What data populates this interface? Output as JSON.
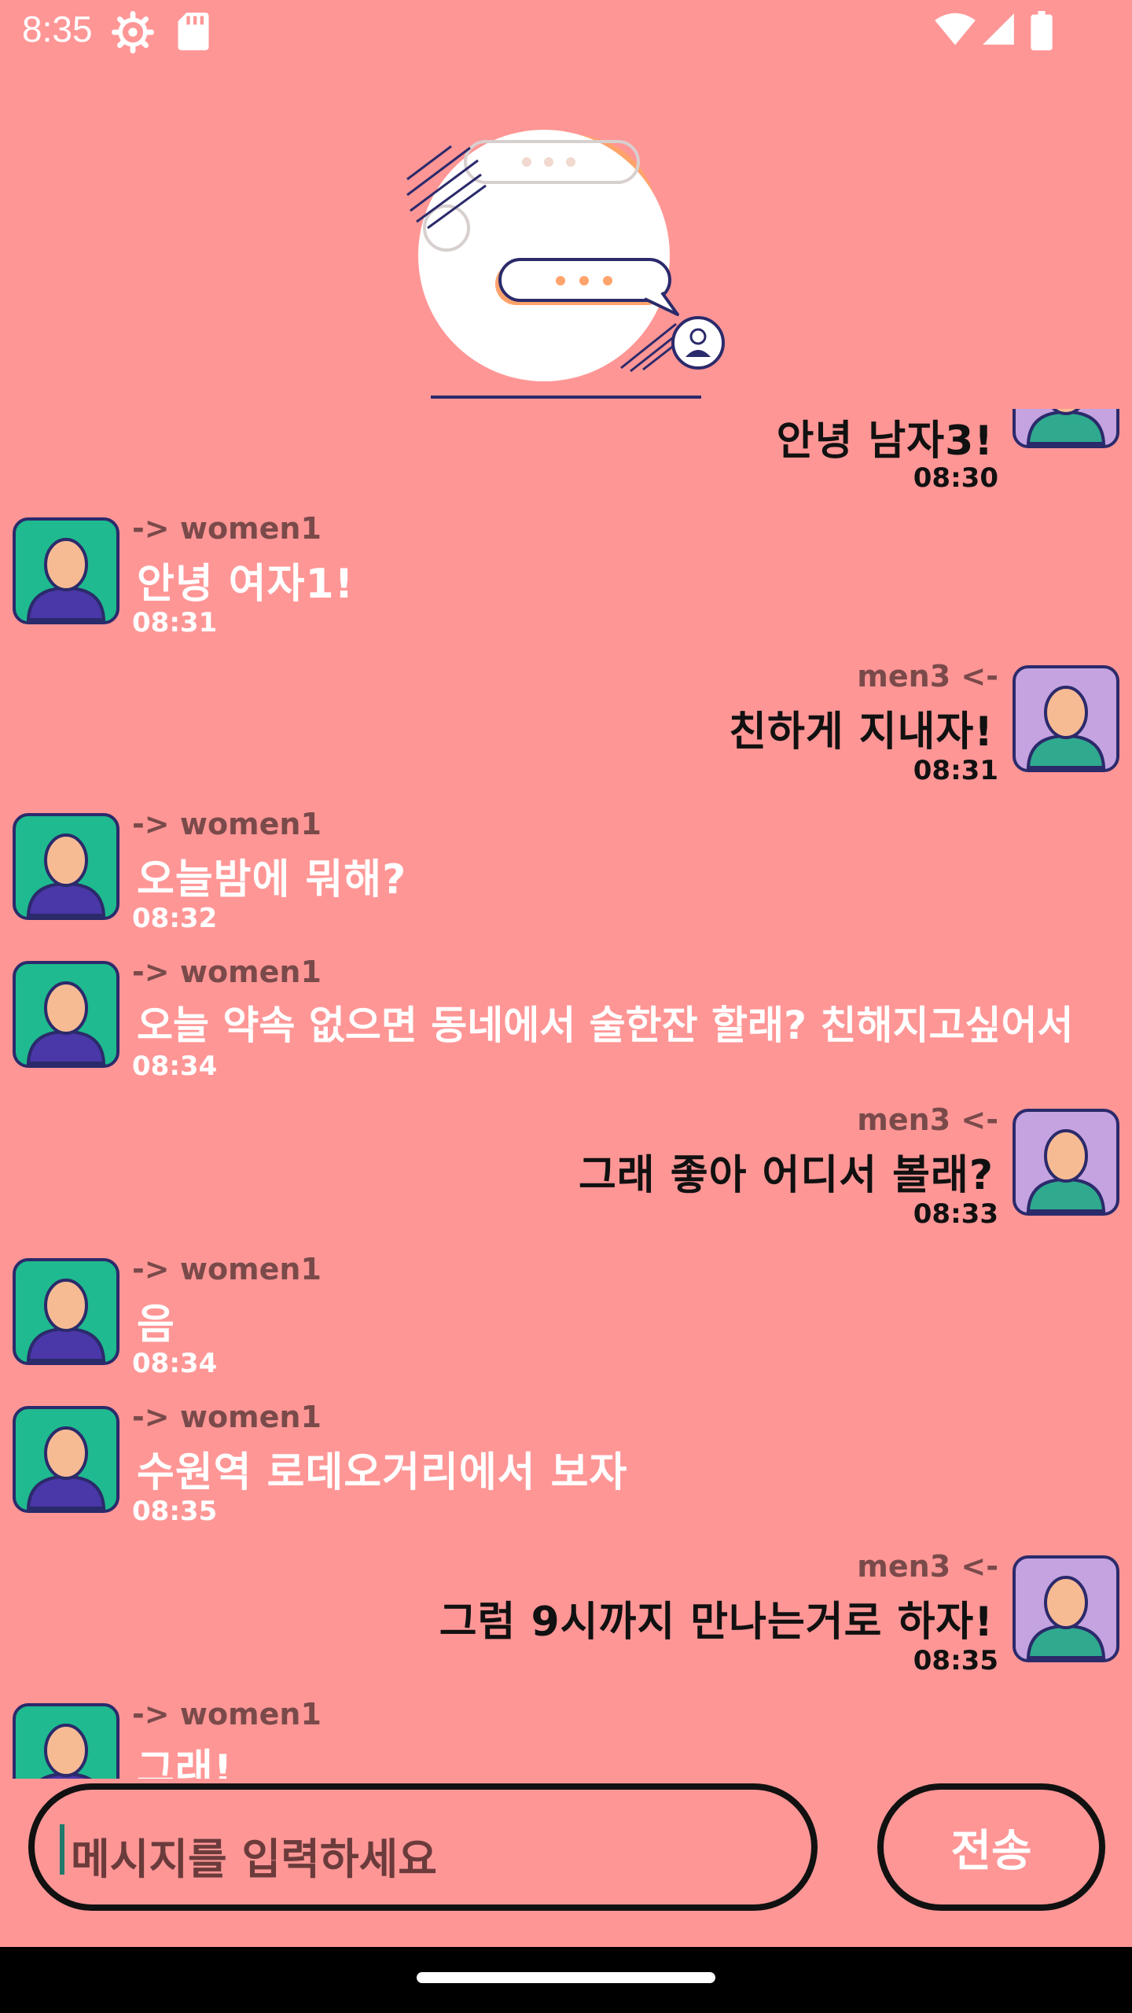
{
  "status_bar": {
    "time": "8:35"
  },
  "messages": [
    {
      "side": "right",
      "sender": "",
      "text": "안녕 남자3!",
      "time": "08:30"
    },
    {
      "side": "left",
      "sender": "-> women1",
      "text": "안녕 여자1!",
      "time": "08:31"
    },
    {
      "side": "right",
      "sender": "men3 <-",
      "text": "친하게 지내자!",
      "time": "08:31"
    },
    {
      "side": "left",
      "sender": "-> women1",
      "text": "오늘밤에 뭐해?",
      "time": "08:32"
    },
    {
      "side": "left",
      "sender": "-> women1",
      "text": "오늘 약속 없으면 동네에서 술한잔 할래? 친해지고싶어서",
      "time": "08:34"
    },
    {
      "side": "right",
      "sender": "men3 <-",
      "text": "그래 좋아 어디서 볼래?",
      "time": "08:33"
    },
    {
      "side": "left",
      "sender": "-> women1",
      "text": "음",
      "time": "08:34"
    },
    {
      "side": "left",
      "sender": "-> women1",
      "text": "수원역 로데오거리에서 보자",
      "time": "08:35"
    },
    {
      "side": "right",
      "sender": "men3 <-",
      "text": "그럼 9시까지 만나는거로 하자!",
      "time": "08:35"
    },
    {
      "side": "left",
      "sender": "-> women1",
      "text": "그래!",
      "time": ""
    }
  ],
  "input": {
    "placeholder": "메시지를 입력하세요"
  },
  "send_button": {
    "label": "전송"
  },
  "colors": {
    "background": "#ff9696",
    "female_avatar_bg": "#1fba8f",
    "male_avatar_bg": "#c4a3e0",
    "accent_orange": "#ffa36c",
    "ink": "#2b2a6b"
  },
  "icons": [
    "settings-gear-icon",
    "sd-card-icon",
    "wifi-icon",
    "signal-icon",
    "battery-icon",
    "chat-illustration",
    "female-avatar-icon",
    "male-avatar-icon"
  ]
}
